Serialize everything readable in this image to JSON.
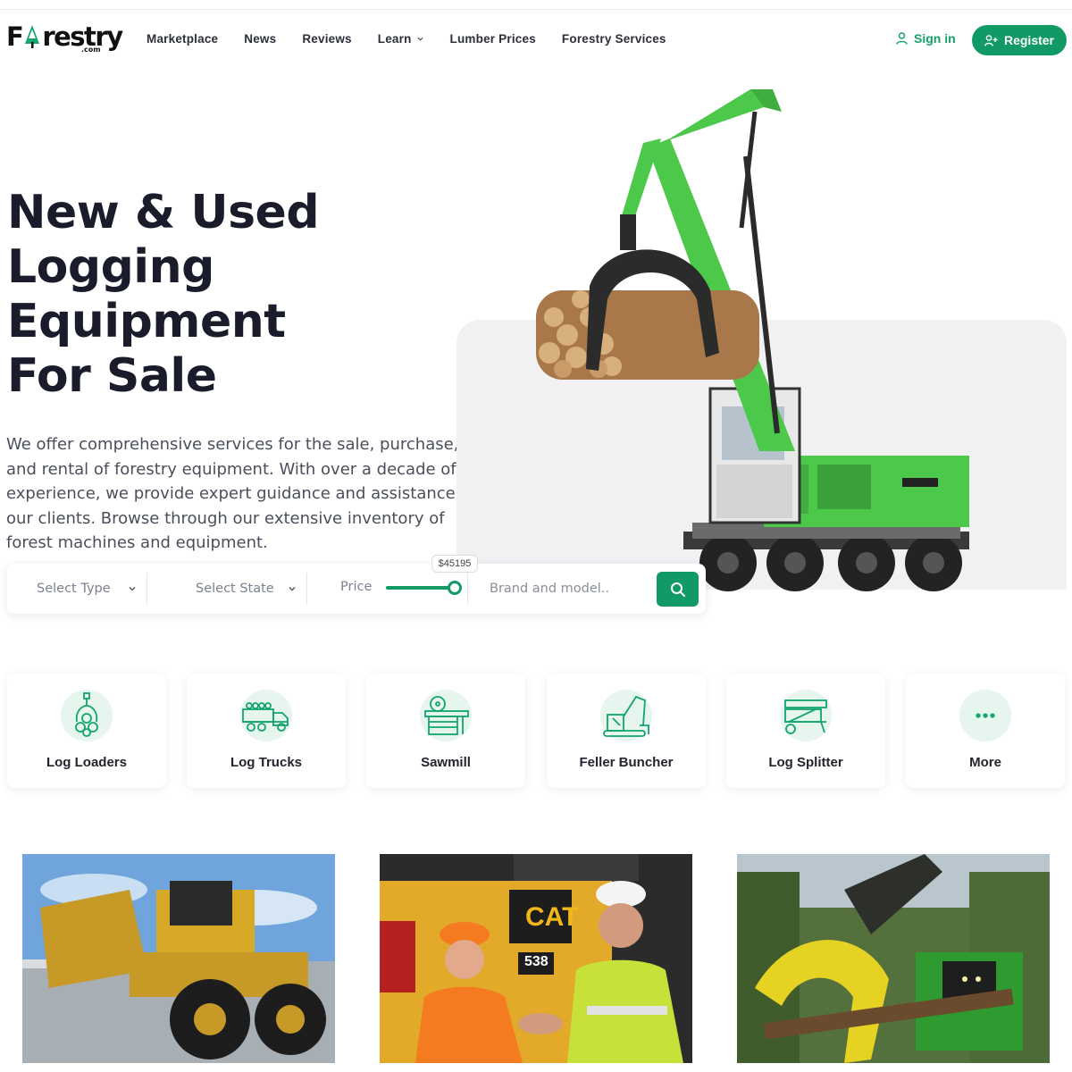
{
  "brand": {
    "name_pre": "F",
    "name_post": "restry",
    "suffix": ".com"
  },
  "nav": {
    "items": [
      "Marketplace",
      "News",
      "Reviews",
      "Learn",
      "Lumber Prices",
      "Forestry Services"
    ]
  },
  "auth": {
    "signin": "Sign in",
    "register": "Register"
  },
  "hero": {
    "title": "New & Used Logging Equipment For Sale",
    "description": "We offer comprehensive services for the sale, purchase, and rental of forestry equipment. With over a decade of experience, we provide expert guidance and assistance to our clients. Browse through our extensive inventory of forest machines and equipment."
  },
  "search": {
    "type_placeholder": "Select Type",
    "state_placeholder": "Select State",
    "price_label": "Price",
    "price_value": "$45195",
    "brand_placeholder": "Brand and model.."
  },
  "categories": [
    {
      "label": "Log Loaders",
      "icon": "log-loader-icon"
    },
    {
      "label": "Log Trucks",
      "icon": "log-truck-icon"
    },
    {
      "label": "Sawmill",
      "icon": "sawmill-icon"
    },
    {
      "label": "Feller Buncher",
      "icon": "feller-buncher-icon"
    },
    {
      "label": "Log Splitter",
      "icon": "log-splitter-icon"
    },
    {
      "label": "More",
      "icon": "more-dots-icon"
    }
  ],
  "photo_text": {
    "cat": "CAT",
    "model": "538"
  },
  "colors": {
    "accent": "#129a66",
    "heading": "#1b1c2b",
    "machine_green": "#4cc94a"
  }
}
